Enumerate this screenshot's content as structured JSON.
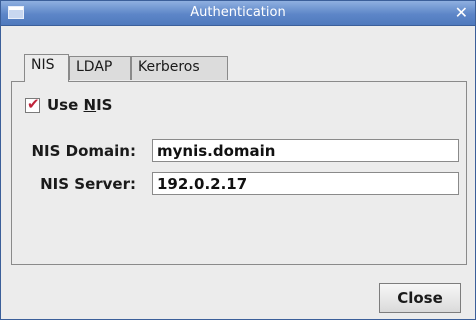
{
  "window": {
    "title": "Authentication",
    "close_glyph": "✕"
  },
  "tabs": [
    {
      "label": "NIS",
      "active": true
    },
    {
      "label": "LDAP",
      "active": false
    },
    {
      "label": "Kerberos",
      "active": false
    }
  ],
  "nis": {
    "use_nis": {
      "label_prefix": "Use ",
      "label_mnemonic": "N",
      "label_suffix": "IS",
      "checked": true
    },
    "domain": {
      "label": "NIS Domain:",
      "value": "mynis.domain"
    },
    "server": {
      "label": "NIS Server:",
      "value": "192.0.2.17"
    }
  },
  "buttons": {
    "close": "Close"
  },
  "colors": {
    "titlebar": "#5d86c8",
    "check_mark": "#c0243b"
  },
  "icons": {
    "window_menu": "window-menu-icon",
    "window_close": "close-icon",
    "checkmark": "checkmark-icon"
  }
}
